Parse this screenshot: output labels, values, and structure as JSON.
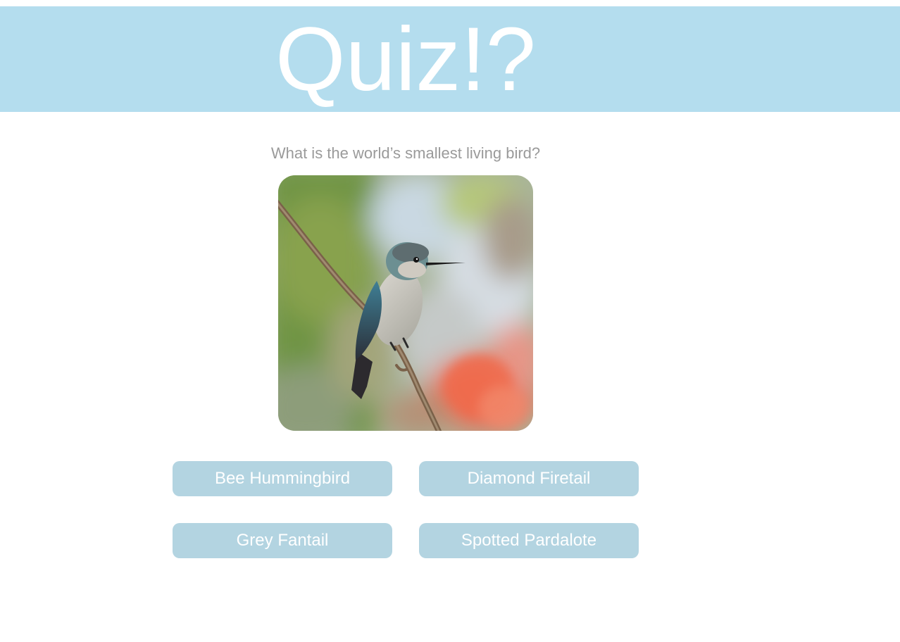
{
  "header": {
    "title": "Quiz!?",
    "background_color": "#b4ddee"
  },
  "question": {
    "text": "What is the world’s smallest living bird?"
  },
  "image": {
    "subject": "hummingbird-on-branch",
    "icon": "bird-photo"
  },
  "answers": [
    {
      "label": "Bee Hummingbird"
    },
    {
      "label": "Diamond Firetail"
    },
    {
      "label": "Grey Fantail"
    },
    {
      "label": "Spotted Pardalote"
    }
  ],
  "colors": {
    "answer_button": "#b3d4e1",
    "answer_text": "#ffffff",
    "question_text": "#9a9a9a"
  }
}
